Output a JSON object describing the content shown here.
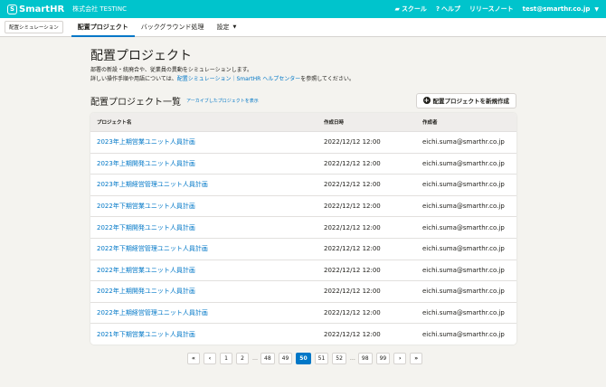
{
  "header": {
    "logo_mark": "S",
    "logo_text": "SmartHR",
    "company": "株式会社 TESTINC",
    "links": [
      {
        "icon": "graduation-cap-icon",
        "glyph": "▰",
        "label": "スクール"
      },
      {
        "icon": "help-icon",
        "glyph": "?",
        "label": "ヘルプ"
      },
      {
        "label": "リリースノート"
      }
    ],
    "user_email": "test@smarthr.co.jp"
  },
  "subnav": {
    "app_chip": "配置シミュレーション",
    "tabs": [
      {
        "label": "配置プロジェクト",
        "active": true
      },
      {
        "label": "バックグラウンド処理",
        "active": false
      },
      {
        "label": "設定",
        "active": false
      }
    ]
  },
  "main": {
    "title": "配置プロジェクト",
    "desc_line1": "部署の新設・統廃合や、従業員の異動をシミュレーションします。",
    "desc_line2_prefix": "詳しい操作手順や用語については、",
    "desc_link": "配置シミュレーション｜SmartHR ヘルプセンター",
    "desc_line2_suffix": "を参照してください。",
    "section_title": "配置プロジェクト一覧",
    "archive_link": "アーカイブしたプロジェクトを表示",
    "create_button": "配置プロジェクトを新規作成"
  },
  "table": {
    "columns": [
      "プロジェクト名",
      "作成日時",
      "作成者"
    ],
    "rows": [
      {
        "name": "2023年上期営業ユニット人員計画",
        "created": "2022/12/12 12:00",
        "author": "eichi.suma@smarthr.co.jp"
      },
      {
        "name": "2023年上期開発ユニット人員計画",
        "created": "2022/12/12 12:00",
        "author": "eichi.suma@smarthr.co.jp"
      },
      {
        "name": "2023年上期経営管理ユニット人員計画",
        "created": "2022/12/12 12:00",
        "author": "eichi.suma@smarthr.co.jp"
      },
      {
        "name": "2022年下期営業ユニット人員計画",
        "created": "2022/12/12 12:00",
        "author": "eichi.suma@smarthr.co.jp"
      },
      {
        "name": "2022年下期開発ユニット人員計画",
        "created": "2022/12/12 12:00",
        "author": "eichi.suma@smarthr.co.jp"
      },
      {
        "name": "2022年下期経営管理ユニット人員計画",
        "created": "2022/12/12 12:00",
        "author": "eichi.suma@smarthr.co.jp"
      },
      {
        "name": "2022年上期営業ユニット人員計画",
        "created": "2022/12/12 12:00",
        "author": "eichi.suma@smarthr.co.jp"
      },
      {
        "name": "2022年上期開発ユニット人員計画",
        "created": "2022/12/12 12:00",
        "author": "eichi.suma@smarthr.co.jp"
      },
      {
        "name": "2022年上期経営管理ユニット人員計画",
        "created": "2022/12/12 12:00",
        "author": "eichi.suma@smarthr.co.jp"
      },
      {
        "name": "2021年下期営業ユニット人員計画",
        "created": "2022/12/12 12:00",
        "author": "eichi.suma@smarthr.co.jp"
      }
    ]
  },
  "pagination": {
    "items": [
      "«",
      "‹",
      "1",
      "2",
      "…",
      "48",
      "49",
      "50",
      "51",
      "52",
      "…",
      "98",
      "99",
      "›",
      "»"
    ],
    "current": "50"
  }
}
